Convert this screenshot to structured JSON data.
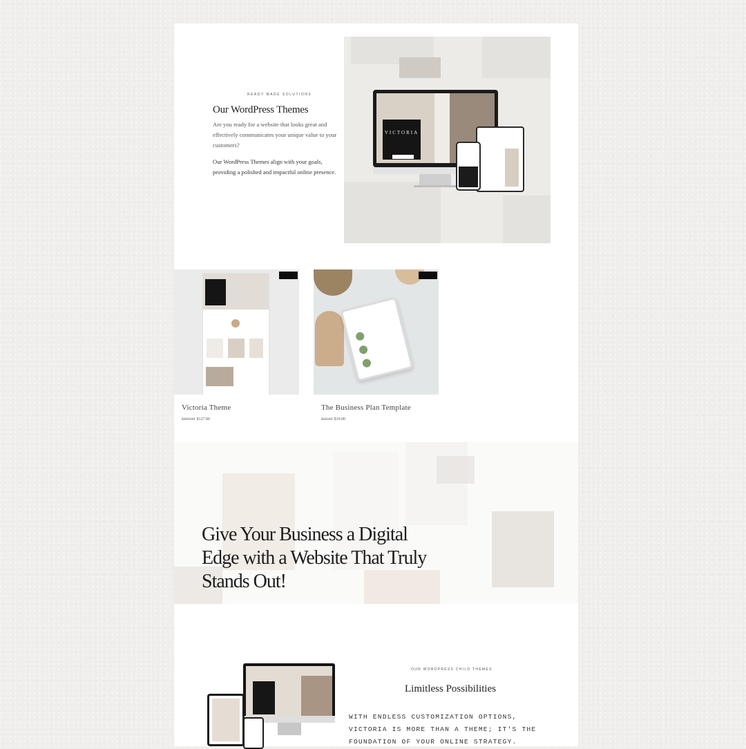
{
  "section_intro": {
    "eyebrow": "READY MADE SOLUTIONS",
    "title": "Our WordPress Themes",
    "paragraph_1": "Are you ready for a website that looks great and effectively communicates your unique value to your customers?",
    "paragraph_2": "Our WordPress Themes align with your goals, providing a polished and impactful online presence.",
    "mockup_brand": "VICTORIA"
  },
  "products": [
    {
      "name": "Victoria Theme",
      "old_price": "$197.00",
      "price": "$127.00"
    },
    {
      "name": "The Business Plan Template",
      "old_price": "$27.00",
      "price": "$19.00"
    }
  ],
  "banner": {
    "headline": "Give Your Business a Digital Edge with a Website That Truly Stands Out!"
  },
  "section_child_themes": {
    "eyebrow": "OUR WORDPRESS CHILD THEMES",
    "title": "Limitless Possibilities",
    "body": "WITH ENDLESS CUSTOMIZATION OPTIONS, VICTORIA IS MORE THAN A THEME; IT'S THE FOUNDATION OF YOUR ONLINE STRATEGY."
  }
}
